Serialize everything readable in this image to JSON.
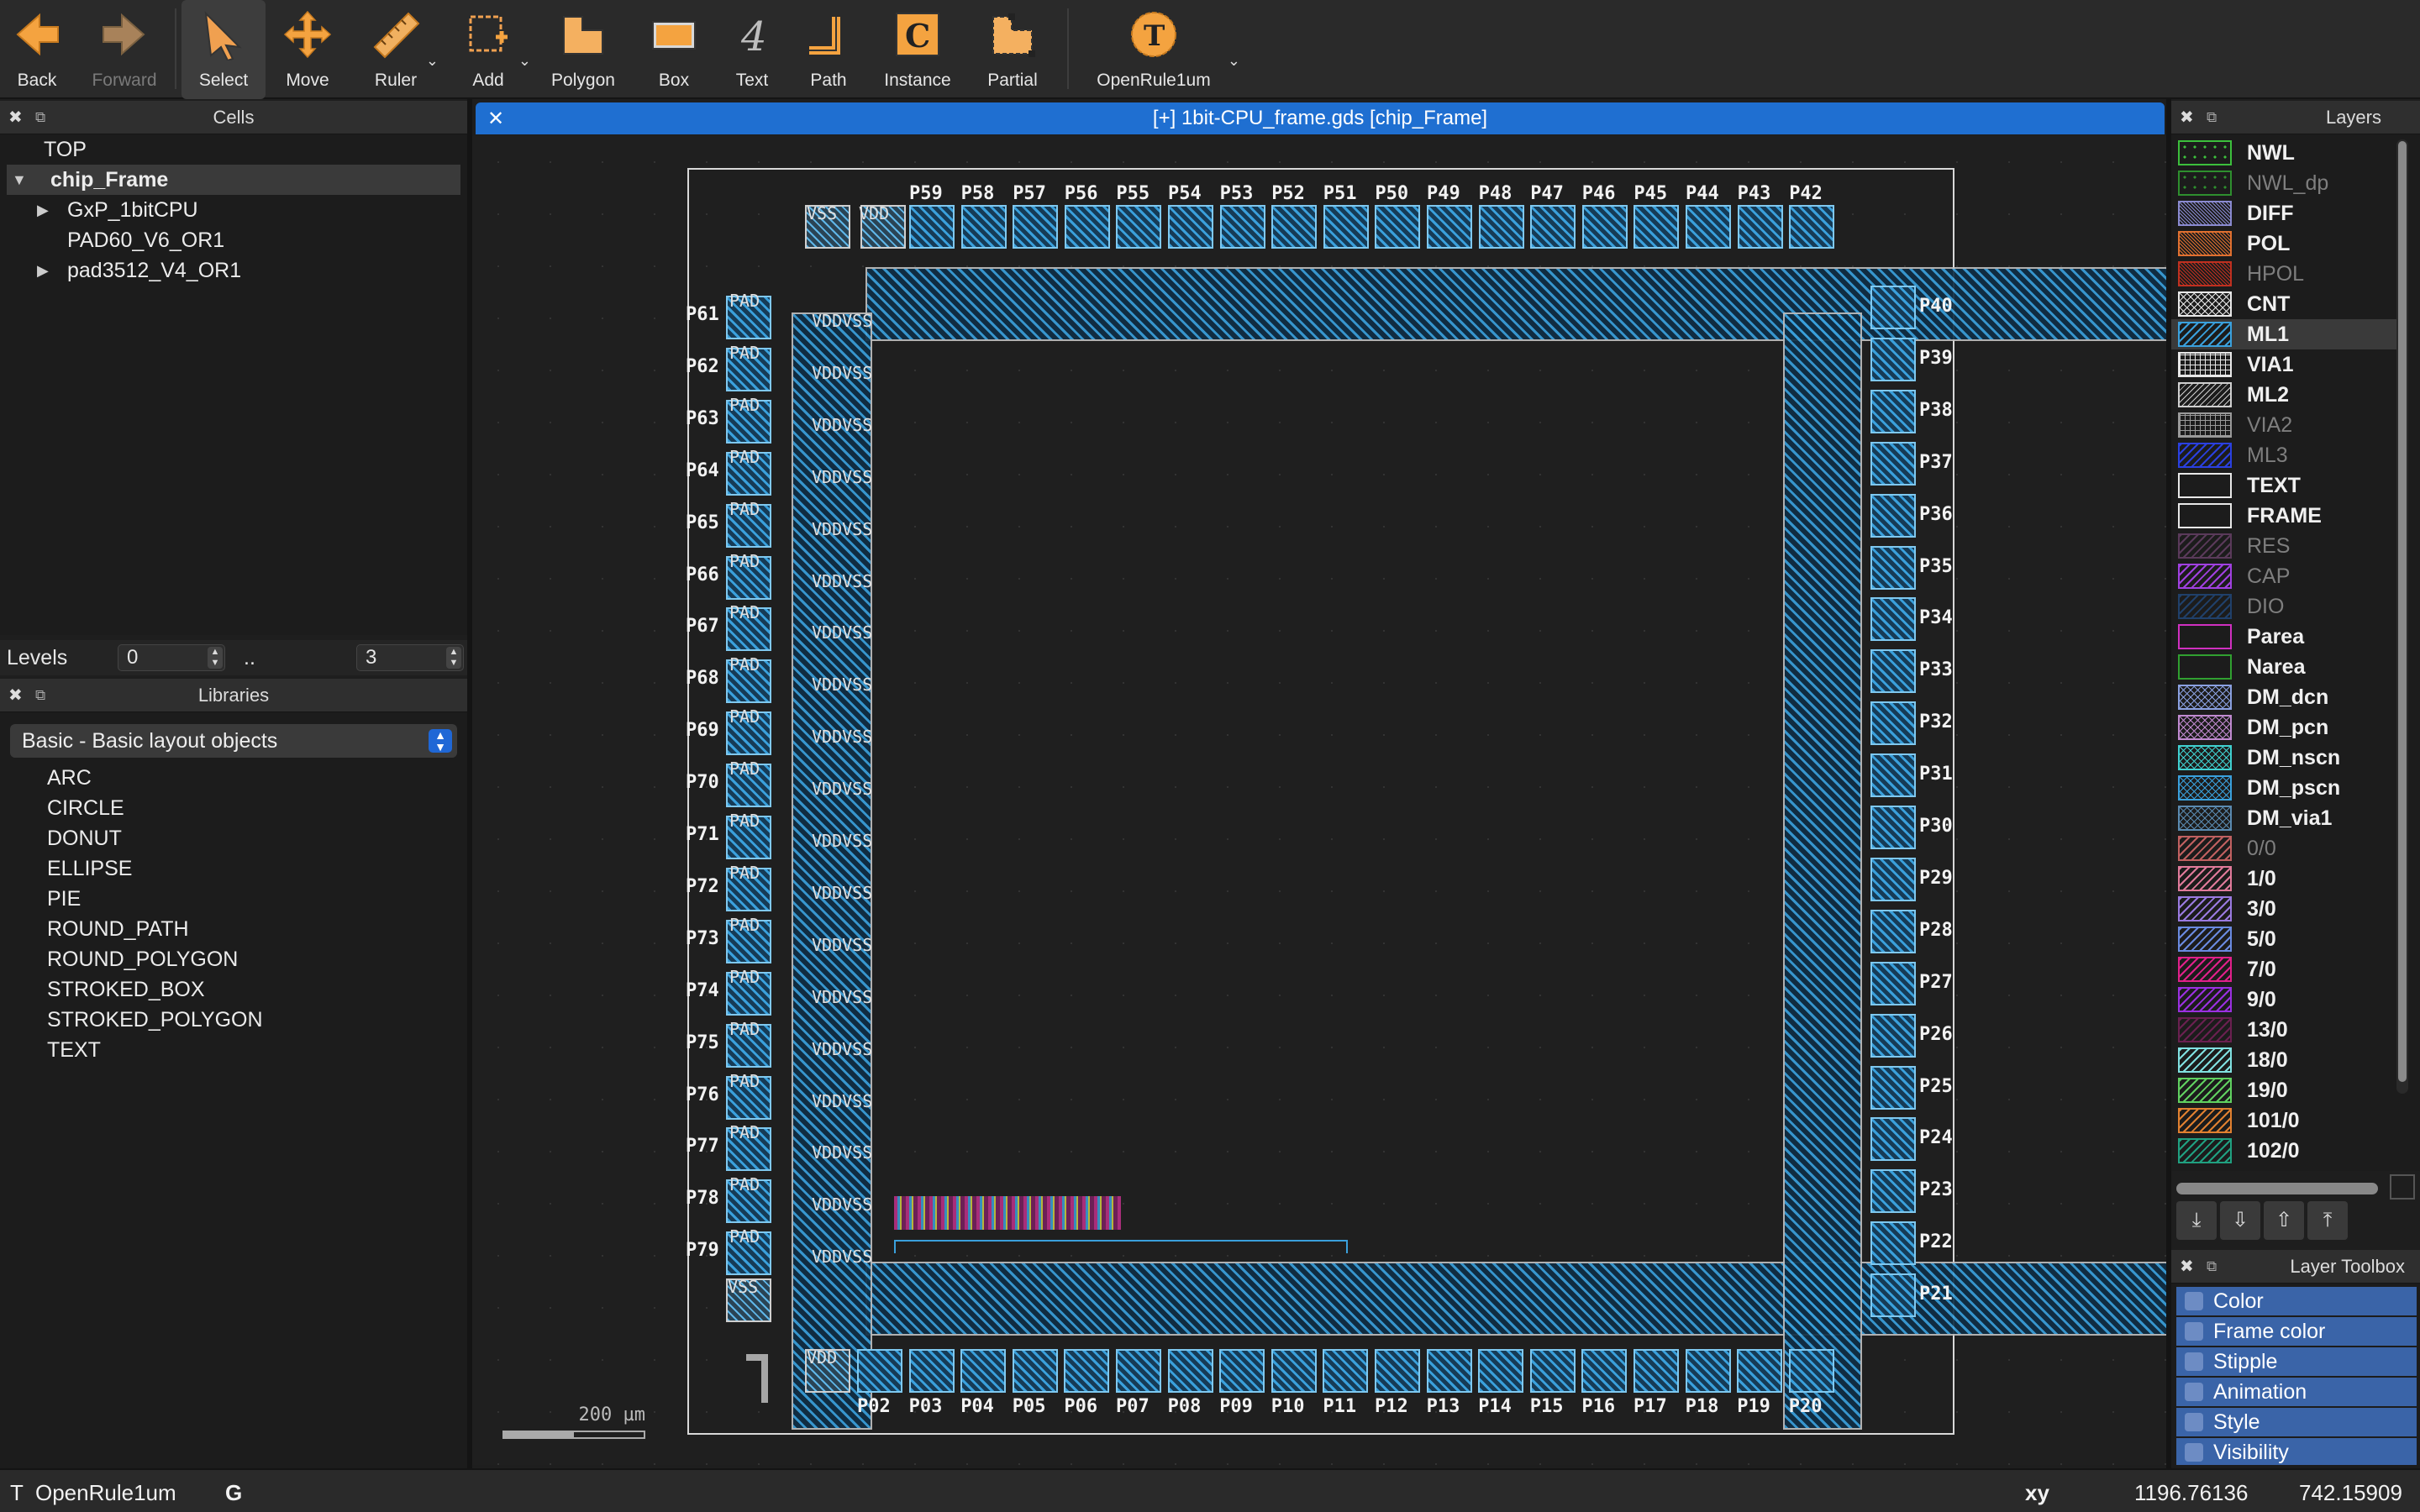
{
  "toolbar": {
    "buttons": [
      {
        "id": "back",
        "label": "Back",
        "icon": "arrow-left-icon"
      },
      {
        "id": "forward",
        "label": "Forward",
        "icon": "arrow-right-icon",
        "disabled": true
      },
      {
        "id": "select",
        "label": "Select",
        "icon": "cursor-icon",
        "active": true
      },
      {
        "id": "move",
        "label": "Move",
        "icon": "move-icon"
      },
      {
        "id": "ruler",
        "label": "Ruler",
        "icon": "ruler-icon"
      },
      {
        "id": "add",
        "label": "Add",
        "icon": "add-icon"
      },
      {
        "id": "polygon",
        "label": "Polygon",
        "icon": "polygon-icon"
      },
      {
        "id": "box",
        "label": "Box",
        "icon": "box-icon"
      },
      {
        "id": "text",
        "label": "Text",
        "icon": "text-icon"
      },
      {
        "id": "path",
        "label": "Path",
        "icon": "path-icon"
      },
      {
        "id": "instance",
        "label": "Instance",
        "icon": "instance-icon"
      },
      {
        "id": "partial",
        "label": "Partial",
        "icon": "partial-icon"
      },
      {
        "id": "techno",
        "label": "OpenRule1um",
        "icon": "technology-icon"
      }
    ]
  },
  "cells_panel": {
    "title": "Cells"
  },
  "cells_tree": [
    {
      "label": "TOP"
    },
    {
      "label": "chip_Frame"
    },
    {
      "label": "GxP_1bitCPU"
    },
    {
      "label": "PAD60_V6_OR1"
    },
    {
      "label": "pad3512_V4_OR1"
    }
  ],
  "levels": {
    "label": "Levels",
    "from": "0",
    "sep": "..",
    "to": "3"
  },
  "libraries_panel": {
    "title": "Libraries",
    "selected": "Basic - Basic layout objects"
  },
  "library_items": [
    "ARC",
    "CIRCLE",
    "DONUT",
    "ELLIPSE",
    "PIE",
    "ROUND_PATH",
    "ROUND_POLYGON",
    "STROKED_BOX",
    "STROKED_POLYGON",
    "TEXT"
  ],
  "document": {
    "tab_title": "[+] 1bit-CPU_frame.gds [chip_Frame]"
  },
  "pads": {
    "top": [
      "P59",
      "P58",
      "P57",
      "P56",
      "P55",
      "P54",
      "P53",
      "P52",
      "P51",
      "P50",
      "P49",
      "P48",
      "P47",
      "P46",
      "P45",
      "P44",
      "P43",
      "P42"
    ],
    "bottom": [
      "P02",
      "P03",
      "P04",
      "P05",
      "P06",
      "P07",
      "P08",
      "P09",
      "P10",
      "P11",
      "P12",
      "P13",
      "P14",
      "P15",
      "P16",
      "P17",
      "P18",
      "P19",
      "P20"
    ],
    "left": [
      "P61",
      "P62",
      "P63",
      "P64",
      "P65",
      "P66",
      "P67",
      "P68",
      "P69",
      "P70",
      "P71",
      "P72",
      "P73",
      "P74",
      "P75",
      "P76",
      "P77",
      "P78",
      "P79"
    ],
    "right": [
      "P40",
      "P39",
      "P38",
      "P37",
      "P36",
      "P35",
      "P34",
      "P33",
      "P32",
      "P31",
      "P30",
      "P29",
      "P28",
      "P27",
      "P26",
      "P25",
      "P24",
      "P23",
      "P22",
      "P21"
    ],
    "corner_vdd": "VDD",
    "corner_vss": "VSS",
    "pad_text": "PAD",
    "vdd_vss_text": "VDDVSS"
  },
  "scale_bar": {
    "label": "200 µm"
  },
  "layers_panel": {
    "title": "Layers"
  },
  "layers": [
    {
      "name": "NWL",
      "color": "#3cbf3c",
      "pattern": "dots"
    },
    {
      "name": "NWL_dp",
      "color": "#2e8f2e",
      "pattern": "dots",
      "dim": true
    },
    {
      "name": "DIFF",
      "color": "#8a8ad0",
      "pattern": "dense"
    },
    {
      "name": "POL",
      "color": "#e07030",
      "pattern": "dense"
    },
    {
      "name": "HPOL",
      "color": "#c03020",
      "pattern": "dense",
      "dim": true
    },
    {
      "name": "CNT",
      "color": "#e8e8e8",
      "pattern": "cross"
    },
    {
      "name": "ML1",
      "color": "#3aa0dc",
      "pattern": "diag",
      "selected": true
    },
    {
      "name": "VIA1",
      "color": "#e8e8e8",
      "pattern": "grid"
    },
    {
      "name": "ML2",
      "color": "#cfcfcf",
      "pattern": "diag2"
    },
    {
      "name": "VIA2",
      "color": "#9a9a9a",
      "pattern": "grid",
      "dim": true
    },
    {
      "name": "ML3",
      "color": "#2a40e0",
      "pattern": "diag",
      "dim": true
    },
    {
      "name": "TEXT",
      "color": "#e8e8e8",
      "pattern": "none"
    },
    {
      "name": "FRAME",
      "color": "#e8e8e8",
      "pattern": "none"
    },
    {
      "name": "RES",
      "color": "#5a3a5a",
      "pattern": "diag",
      "dim": true
    },
    {
      "name": "CAP",
      "color": "#a040e0",
      "pattern": "diag",
      "dim": true
    },
    {
      "name": "DIO",
      "color": "#20406a",
      "pattern": "diag",
      "dim": true
    },
    {
      "name": "Parea",
      "color": "#d030c0",
      "pattern": "none"
    },
    {
      "name": "Narea",
      "color": "#30a030",
      "pattern": "none"
    },
    {
      "name": "DM_dcn",
      "color": "#8aa0e0",
      "pattern": "cross"
    },
    {
      "name": "DM_pcn",
      "color": "#c08ad0",
      "pattern": "cross"
    },
    {
      "name": "DM_nscn",
      "color": "#40d0d0",
      "pattern": "cross"
    },
    {
      "name": "DM_pscn",
      "color": "#3aa0dc",
      "pattern": "cross"
    },
    {
      "name": "DM_via1",
      "color": "#5a8ab0",
      "pattern": "cross"
    },
    {
      "name": "0/0",
      "color": "#c06060",
      "pattern": "diag",
      "dim": true
    },
    {
      "name": "1/0",
      "color": "#e07a9a",
      "pattern": "diag"
    },
    {
      "name": "3/0",
      "color": "#9a7ae0",
      "pattern": "diag"
    },
    {
      "name": "5/0",
      "color": "#6a8ae0",
      "pattern": "diag"
    },
    {
      "name": "7/0",
      "color": "#e0208a",
      "pattern": "diag"
    },
    {
      "name": "9/0",
      "color": "#9a30e0",
      "pattern": "diag"
    },
    {
      "name": "13/0",
      "color": "#6a2050",
      "pattern": "diag"
    },
    {
      "name": "18/0",
      "color": "#80e0e0",
      "pattern": "diag"
    },
    {
      "name": "19/0",
      "color": "#60d060",
      "pattern": "diag"
    },
    {
      "name": "101/0",
      "color": "#e08030",
      "pattern": "diag"
    },
    {
      "name": "102/0",
      "color": "#20a080",
      "pattern": "diag"
    }
  ],
  "layer_toolbox": {
    "title": "Layer Toolbox",
    "items": [
      "Color",
      "Frame color",
      "Stipple",
      "Animation",
      "Style",
      "Visibility"
    ]
  },
  "statusbar": {
    "tech": "OpenRule1um",
    "tech_prefix": "T",
    "grid": "G",
    "xy_label": "xy",
    "x": "1196.76136",
    "y": "742.15909"
  }
}
